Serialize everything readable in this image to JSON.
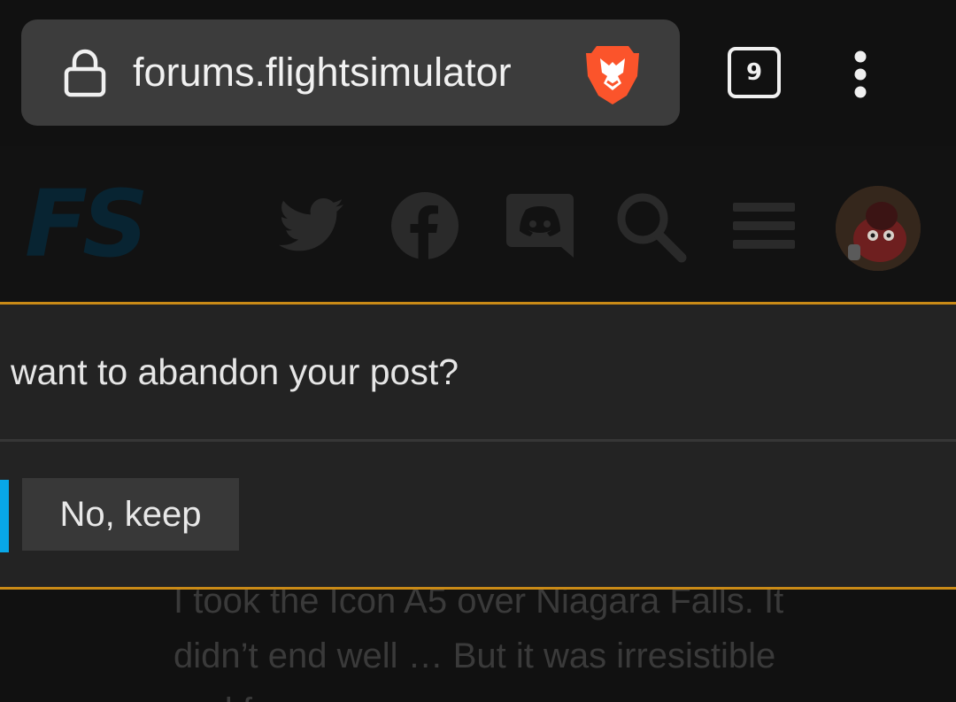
{
  "browser": {
    "url": "forums.flightsimulator",
    "tab_count": "9",
    "icons": [
      "lock-icon",
      "brave-lion-icon",
      "tabs-icon",
      "more-vert-icon"
    ]
  },
  "site_header": {
    "logo": "FS",
    "icons": [
      "twitter-icon",
      "facebook-icon",
      "discord-icon",
      "search-icon",
      "hamburger-menu-icon",
      "user-avatar"
    ]
  },
  "dialog": {
    "message": "want to abandon your post?",
    "keep_button_label": "No, keep"
  },
  "background_post": {
    "lines": [
      "I took the Icon A5 over Niagara Falls. It",
      "didn’t end well … But it was irresistible",
      "and fun"
    ]
  },
  "colors": {
    "accent_border": "#c98a17",
    "focus_indicator": "#08a7e8",
    "brave_orange": "#fb542b"
  }
}
